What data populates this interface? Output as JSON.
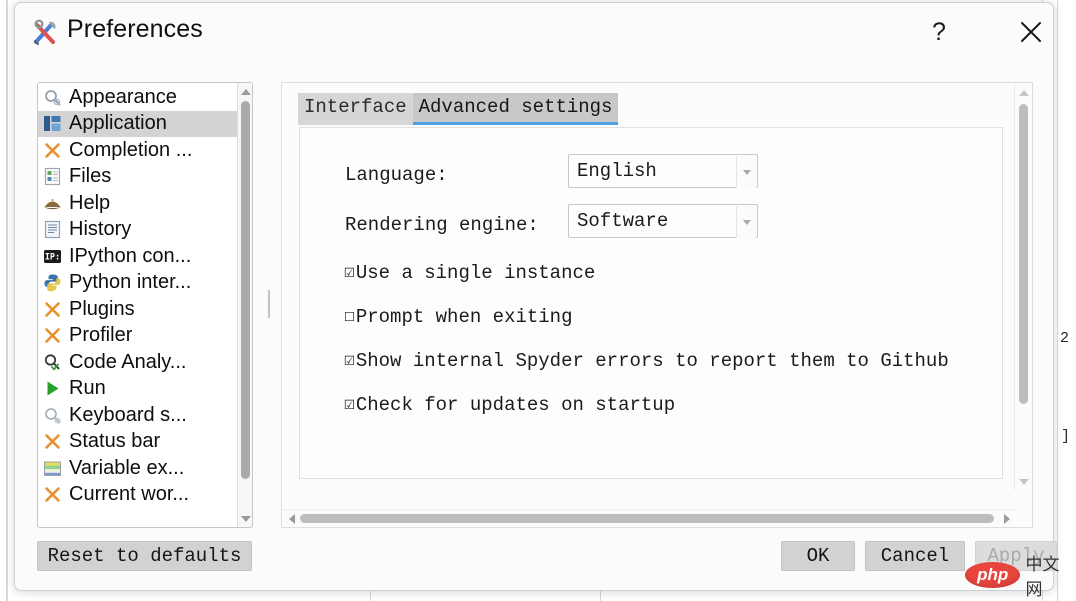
{
  "window": {
    "title": "Preferences",
    "icon": "tools-icon",
    "help_label": "?",
    "close_label": "✕"
  },
  "sidebar": {
    "items": [
      {
        "label": "Appearance",
        "icon": "appearance-magnifier-icon",
        "selected": false
      },
      {
        "label": "Application",
        "icon": "application-layout-icon",
        "selected": true
      },
      {
        "label": "Completion ...",
        "icon": "x-orange-icon",
        "selected": false
      },
      {
        "label": "Files",
        "icon": "files-icon",
        "selected": false
      },
      {
        "label": "Help",
        "icon": "help-hat-icon",
        "selected": false
      },
      {
        "label": "History",
        "icon": "history-notepad-icon",
        "selected": false
      },
      {
        "label": "IPython con...",
        "icon": "ipython-console-icon",
        "selected": false
      },
      {
        "label": "Python inter...",
        "icon": "python-interpreter-icon",
        "selected": false
      },
      {
        "label": "Plugins",
        "icon": "x-orange-icon",
        "selected": false
      },
      {
        "label": "Profiler",
        "icon": "x-orange-icon",
        "selected": false
      },
      {
        "label": "Code Analy...",
        "icon": "code-analysis-icon",
        "selected": false
      },
      {
        "label": "Run",
        "icon": "run-play-icon",
        "selected": false
      },
      {
        "label": "Keyboard s...",
        "icon": "keyboard-shortcuts-icon",
        "selected": false
      },
      {
        "label": "Status bar",
        "icon": "x-orange-icon",
        "selected": false
      },
      {
        "label": "Variable ex...",
        "icon": "variable-explorer-icon",
        "selected": false
      },
      {
        "label": "Current wor...",
        "icon": "x-orange-icon",
        "selected": false
      }
    ],
    "scrollbar": {
      "up_arrow": "scroll-up-arrow",
      "down_arrow": "scroll-down-arrow"
    }
  },
  "panel": {
    "tabs": [
      {
        "label": "Interface",
        "active": false
      },
      {
        "label": "Advanced settings",
        "active": true
      }
    ],
    "form": {
      "language": {
        "label": "Language:",
        "value": "English"
      },
      "rendering_engine": {
        "label": "Rendering engine:",
        "value": "Software"
      }
    },
    "checkboxes": [
      {
        "label": "Use a single instance",
        "checked": true,
        "glyph": "☑"
      },
      {
        "label": "Prompt when exiting",
        "checked": false,
        "glyph": "☐"
      },
      {
        "label": "Show internal Spyder errors to report them to Github",
        "checked": true,
        "glyph": "☑"
      },
      {
        "label": "Check for updates on startup",
        "checked": true,
        "glyph": "☑"
      }
    ]
  },
  "footer": {
    "reset_label": "Reset to defaults",
    "ok_label": "OK",
    "cancel_label": "Cancel",
    "apply_label": "Apply",
    "apply_disabled": true
  },
  "background": {
    "text_fragments": [
      "2",
      "]"
    ]
  },
  "watermark": {
    "logo_text": "php",
    "cn_text": "中文网"
  },
  "colors": {
    "accent_tab_underline": "#4aa3e8",
    "selection": "#d3d3d3",
    "dialog_bg": "#fbfbfb",
    "orange_x": "#e8912a",
    "watermark_red": "#e8453c"
  }
}
